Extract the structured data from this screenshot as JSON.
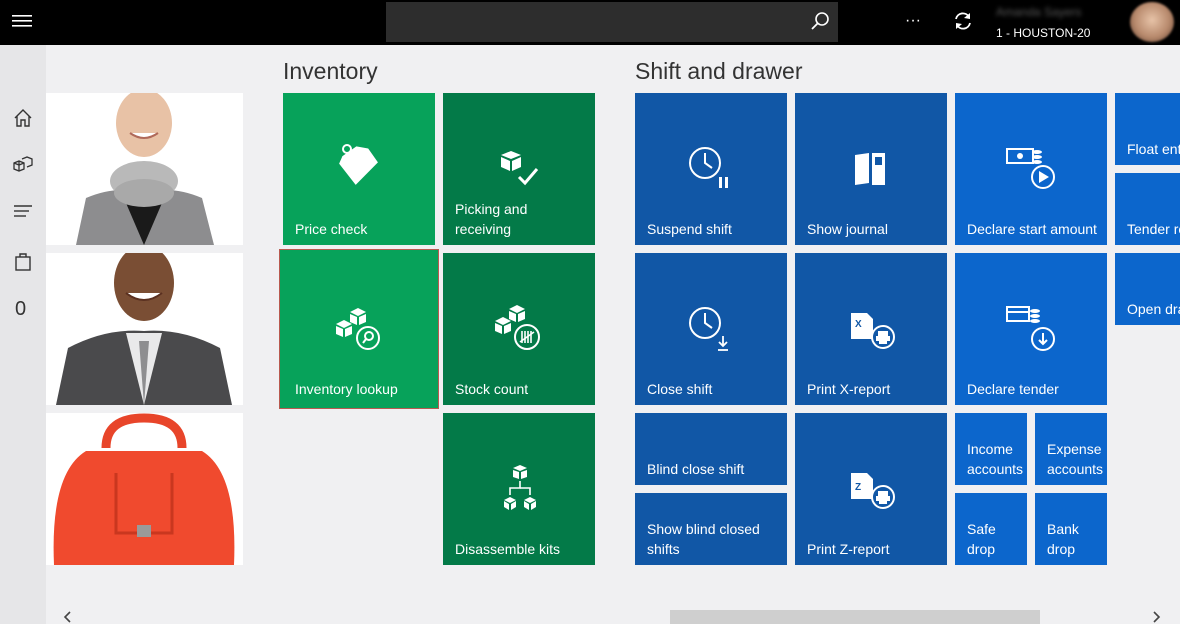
{
  "header": {
    "user_name": "Amanda Sayers",
    "store": "1 - HOUSTON-20",
    "more_label": "···"
  },
  "rail": {
    "cart_count": "0"
  },
  "sections": {
    "inventory": "Inventory",
    "shift": "Shift and drawer"
  },
  "tiles": {
    "price_check": "Price check",
    "picking": "Picking and receiving",
    "inventory_lookup": "Inventory lookup",
    "stock_count": "Stock count",
    "disassemble": "Disassemble kits",
    "suspend_shift": "Suspend shift",
    "show_journal": "Show journal",
    "declare_start": "Declare start amount",
    "float_entry": "Float entry",
    "tender_removal": "Tender removal",
    "close_shift": "Close shift",
    "print_x": "Print X-report",
    "declare_tender": "Declare tender",
    "open_drawer": "Open drawer",
    "blind_close": "Blind close shift",
    "show_blind_closed_1": "Show blind closed",
    "show_blind_closed_2": "shifts",
    "print_z": "Print Z-report",
    "income_1": "Income",
    "income_2": "accounts",
    "expense_1": "Expense",
    "expense_2": "accounts",
    "safe_1": "Safe",
    "safe_2": "drop",
    "bank_1": "Bank",
    "bank_2": "drop"
  },
  "colors": {
    "green": "#07a25a",
    "dark_green": "#037a48",
    "blue": "#1157a6",
    "bright_blue": "#0c66cc"
  }
}
